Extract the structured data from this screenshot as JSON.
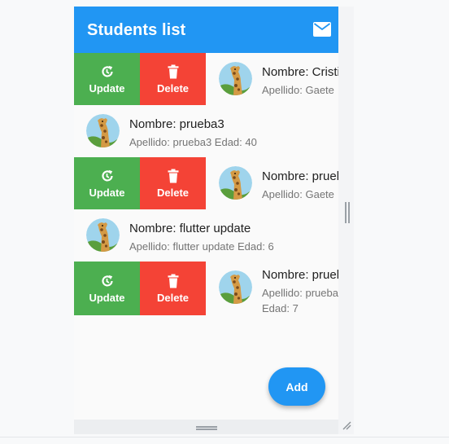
{
  "appbar": {
    "title": "Students list",
    "icon": "mail-icon"
  },
  "actions": {
    "update_label": "Update",
    "delete_label": "Delete",
    "update_icon": "refresh-icon",
    "delete_icon": "trash-icon"
  },
  "students": [
    {
      "name": "Nombre: Cristian",
      "detail": "Apellido: Gaete",
      "swiped": true
    },
    {
      "name": "Nombre: prueba3",
      "detail": "Apellido: prueba3 Edad: 40",
      "swiped": false
    },
    {
      "name": "Nombre: prueba",
      "detail": "Apellido: Gaete",
      "swiped": true
    },
    {
      "name": "Nombre: flutter update",
      "detail": "Apellido: flutter update Edad: 6",
      "swiped": false
    },
    {
      "name": "Nombre: prueba",
      "detail": "Apellido: prueba Edad: 7",
      "swiped": true
    }
  ],
  "fab": {
    "label": "Add"
  },
  "colors": {
    "primary": "#2196f3",
    "update": "#4caf50",
    "delete": "#f44336"
  }
}
